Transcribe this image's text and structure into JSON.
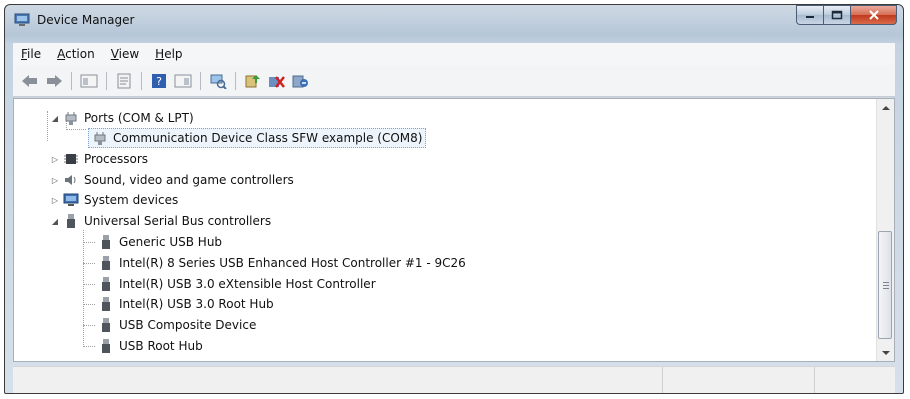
{
  "window": {
    "title": "Device Manager"
  },
  "menu": {
    "items": [
      {
        "label_ul": "F",
        "label_rest": "ile"
      },
      {
        "label_ul": "A",
        "label_rest": "ction"
      },
      {
        "label_ul": "V",
        "label_rest": "iew"
      },
      {
        "label_ul": "H",
        "label_rest": "elp"
      }
    ]
  },
  "toolbar": {
    "icons": [
      "back-icon",
      "forward-icon",
      "show-hide-console-tree-icon",
      "properties-icon",
      "help-icon",
      "show-hide-action-pane-icon",
      "scan-hardware-icon",
      "update-driver-icon",
      "uninstall-icon",
      "disable-icon"
    ]
  },
  "tree": {
    "ports": "Ports (COM & LPT)",
    "com_device": "Communication Device Class SFW example (COM8)",
    "processors": "Processors",
    "sound": "Sound, video and game controllers",
    "system": "System devices",
    "usb": "Universal Serial Bus controllers",
    "usb_children": [
      "Generic USB Hub",
      "Intel(R) 8 Series USB Enhanced Host Controller #1 - 9C26",
      "Intel(R) USB 3.0 eXtensible Host Controller",
      "Intel(R) USB 3.0 Root Hub",
      "USB Composite Device",
      "USB Root Hub"
    ]
  },
  "colors": {
    "accent": "#3c6fb1",
    "close": "#c0391d"
  }
}
